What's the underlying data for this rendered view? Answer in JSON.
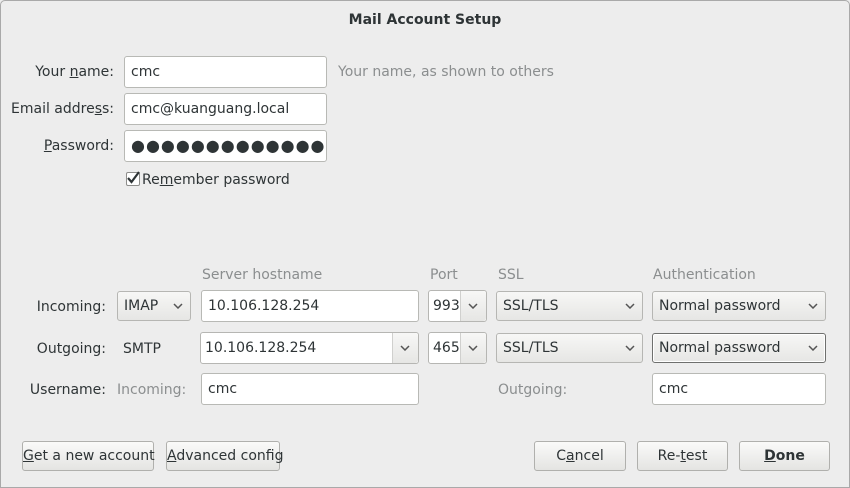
{
  "window": {
    "title": "Mail Account Setup"
  },
  "identity": {
    "name_label": "Your name:",
    "name_value": "cmc",
    "name_hint": "Your name, as shown to others",
    "email_label": "Email address:",
    "email_value": "cmc@kuanguang.local",
    "password_label": "Password:",
    "password_value": "●●●●●●●●●●●●●●●",
    "remember_label": "Remember password",
    "remember_checked": true
  },
  "servers": {
    "headers": {
      "hostname": "Server hostname",
      "port": "Port",
      "ssl": "SSL",
      "auth": "Authentication"
    },
    "incoming": {
      "label": "Incoming:",
      "protocol": "IMAP",
      "hostname": "10.106.128.254",
      "port": "993",
      "ssl": "SSL/TLS",
      "auth": "Normal password"
    },
    "outgoing": {
      "label": "Outgoing:",
      "protocol": "SMTP",
      "hostname": "10.106.128.254",
      "port": "465",
      "ssl": "SSL/TLS",
      "auth": "Normal password"
    },
    "username": {
      "label": "Username:",
      "incoming_label": "Incoming:",
      "incoming_value": "cmc",
      "outgoing_label": "Outgoing:",
      "outgoing_value": "cmc"
    }
  },
  "buttons": {
    "get_account": "Get a new account",
    "advanced": "Advanced config",
    "cancel": "Cancel",
    "retest": "Re-test",
    "done": "Done"
  }
}
